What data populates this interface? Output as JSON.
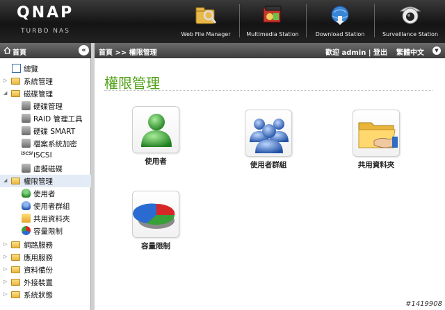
{
  "header": {
    "logo": "QNAP",
    "logo_sub": "TURBO NAS",
    "apps": [
      {
        "label": "Web File Manager",
        "icon": "web-file-manager-icon"
      },
      {
        "label": "Multimedia Station",
        "icon": "multimedia-station-icon"
      },
      {
        "label": "Download Station",
        "icon": "download-station-icon"
      },
      {
        "label": "Surveillance Station",
        "icon": "surveillance-station-icon"
      }
    ]
  },
  "sidebar": {
    "title": "首頁",
    "collapse_label": "«",
    "items": [
      {
        "label": "總覽"
      },
      {
        "label": "系統管理"
      },
      {
        "label": "磁碟管理"
      },
      {
        "label": "硬碟管理"
      },
      {
        "label": "RAID 管理工具"
      },
      {
        "label": "硬碟 SMART"
      },
      {
        "label": "檔案系統加密"
      },
      {
        "label": "iSCSI"
      },
      {
        "label": "虛擬磁碟"
      },
      {
        "label": "權限管理"
      },
      {
        "label": "使用者"
      },
      {
        "label": "使用者群組"
      },
      {
        "label": "共用資料夾"
      },
      {
        "label": "容量限制"
      },
      {
        "label": "網路服務"
      },
      {
        "label": "應用服務"
      },
      {
        "label": "資料備份"
      },
      {
        "label": "外接裝置"
      },
      {
        "label": "系統狀態"
      }
    ]
  },
  "topbar": {
    "breadcrumb": "首頁 >> 權限管理",
    "welcome": "歡迎 admin | 登出",
    "language": "繁體中文"
  },
  "main": {
    "title": "權限管理",
    "tiles": [
      {
        "label": "使用者",
        "icon": "user-icon"
      },
      {
        "label": "使用者群組",
        "icon": "user-group-icon"
      },
      {
        "label": "共用資料夾",
        "icon": "shared-folder-icon"
      },
      {
        "label": "容量限制",
        "icon": "quota-icon"
      }
    ]
  },
  "watermark": "#1419908",
  "colors": {
    "accent": "#4fa014",
    "header_bg": "#1e1e1e",
    "selected_bg": "#e3ebf7"
  }
}
